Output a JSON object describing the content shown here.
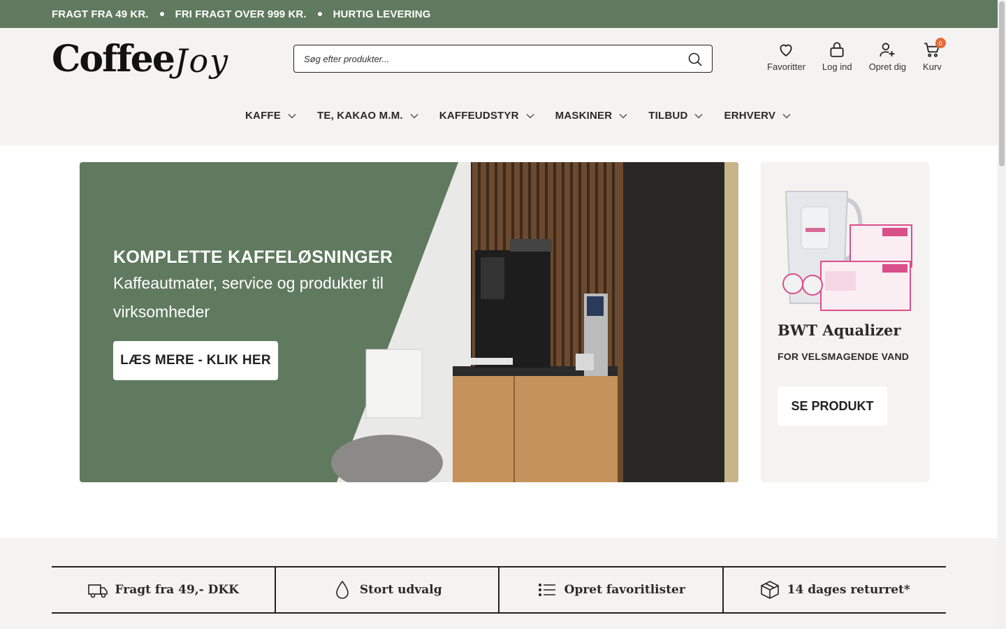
{
  "topbar": {
    "items": [
      "FRAGT FRA 49 KR.",
      "FRI FRAGT OVER 999 KR.",
      "HURTIG LEVERING"
    ]
  },
  "logo": {
    "word": "Coffee",
    "script": "Joy"
  },
  "search": {
    "placeholder": "Søg efter produkter..."
  },
  "actions": {
    "favorites": "Favoritter",
    "login": "Log ind",
    "register": "Opret dig",
    "cart": "Kurv",
    "cart_count": "0"
  },
  "nav": [
    "KAFFE",
    "TE, KAKAO M.M.",
    "KAFFEUDSTYR",
    "MASKINER",
    "TILBUD",
    "ERHVERV"
  ],
  "hero": {
    "title": "KOMPLETTE KAFFELØSNINGER",
    "subtitle": "Kaffeautmater, service og produkter til virksomheder",
    "button": "LÆS MERE - KLIK HER"
  },
  "promo": {
    "title": "BWT Aqualizer",
    "subtitle": "FOR VELSMAGENDE VAND",
    "button": "SE PRODUKT"
  },
  "usps": [
    "Fragt fra 49,- DKK",
    "Stort udvalg",
    "Opret favoritlister",
    "14 dages returret*"
  ],
  "colors": {
    "brand_green": "#5f7a5e",
    "header_bg": "#f5f3f1",
    "badge": "#e36a3a"
  }
}
